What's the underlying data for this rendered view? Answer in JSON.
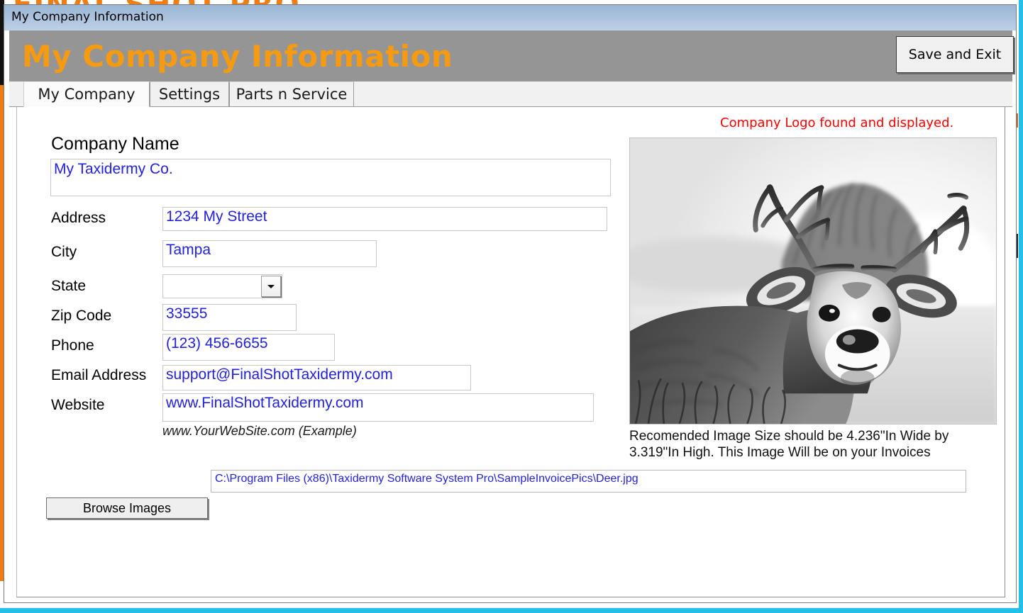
{
  "background": {
    "logo_text": "FINAL SHOT PRO"
  },
  "window": {
    "titlebar_text": "My Company Information",
    "header_title": "My Company Information",
    "save_exit_label": "Save and Exit"
  },
  "tabs": [
    {
      "label": "My Company",
      "selected": true
    },
    {
      "label": "Settings",
      "selected": false
    },
    {
      "label": "Parts n Service",
      "selected": false
    }
  ],
  "form": {
    "company_name_label": "Company Name",
    "company_name_value": "My Taxidermy Co.",
    "fields": [
      {
        "label": "Address",
        "value": "1234 My Street"
      },
      {
        "label": "City",
        "value": "Tampa"
      },
      {
        "label": "State",
        "value": ""
      },
      {
        "label": "Zip Code",
        "value": "33555"
      },
      {
        "label": "Phone",
        "value": "(123) 456-6655"
      },
      {
        "label": "Email Address",
        "value": "support@FinalShotTaxidermy.com"
      },
      {
        "label": "Website",
        "value": "www.FinalShotTaxidermy.com"
      }
    ],
    "website_hint": "www.YourWebSite.com (Example)",
    "image_path_value": "C:\\Program Files (x86)\\Taxidermy Software System Pro\\SampleInvoicePics\\Deer.jpg",
    "browse_label": "Browse Images"
  },
  "logo_panel": {
    "status_text": "Company Logo found and displayed.",
    "status_color": "#ff0000",
    "image_alt": "deer-buck-grayscale-logo",
    "recommendation": "Recomended Image Size should be 4.236\"In Wide by 3.319\"In High. This Image Will be on your Invoices"
  },
  "colors": {
    "header_bar": "#959595",
    "header_title": "#f59a11",
    "titlebar_gradient_top": "#9bb6d5",
    "titlebar_gradient_bottom": "#bdd1e6",
    "field_text": "#2222dd",
    "accent_orange": "#f07d12",
    "accent_cyan": "#24c0e8"
  }
}
